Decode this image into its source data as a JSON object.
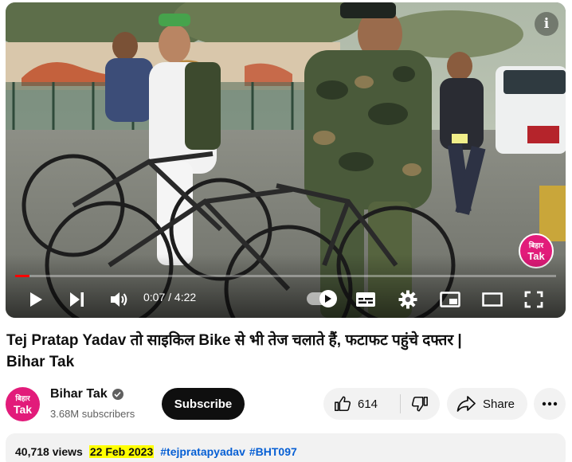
{
  "player": {
    "current_time": "0:07",
    "duration": "4:22",
    "progress_fraction": 0.027,
    "watermark_line1": "बिहार",
    "watermark_line2": "Tak",
    "info_icon": "info-icon"
  },
  "video": {
    "title_line1": "Tej Pratap Yadav तो साइकिल Bike से भी तेज चलाते हैं, फटाफट पहुंचे दफ्तर |",
    "title_line2": "Bihar Tak"
  },
  "channel": {
    "avatar_line1": "बिहार",
    "avatar_line2": "Tak",
    "name": "Bihar Tak",
    "subscribers": "3.68M subscribers",
    "subscribe_label": "Subscribe"
  },
  "actions": {
    "like_count": "614",
    "share_label": "Share"
  },
  "description": {
    "views": "40,718 views",
    "date": "22 Feb 2023",
    "hashtags": [
      "#tejpratapyadav",
      "#BHT097"
    ]
  },
  "colors": {
    "brand_pink": "#e21b7a",
    "progress_red": "#ff0000",
    "date_highlight": "#ffff00",
    "hashtag_blue": "#065fd4"
  }
}
